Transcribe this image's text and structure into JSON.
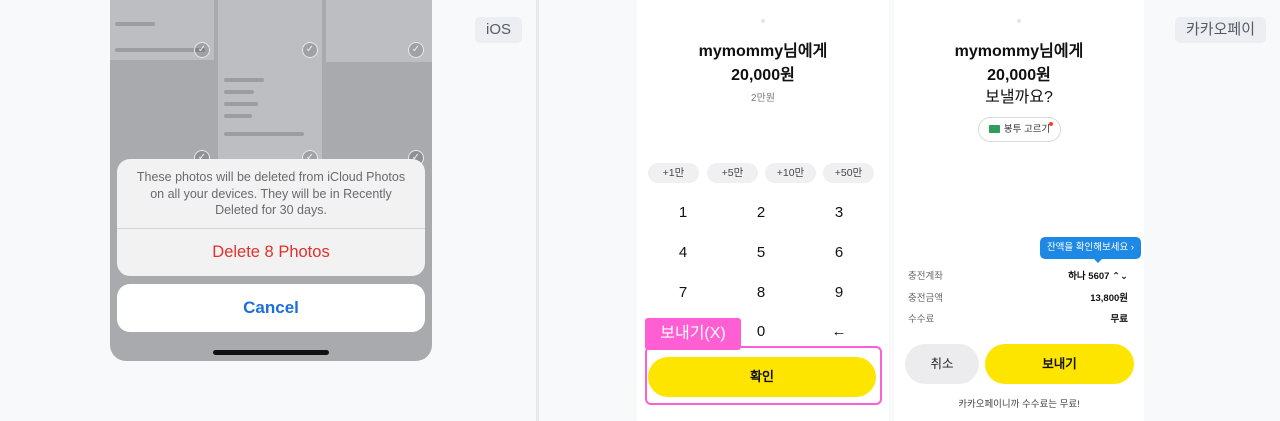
{
  "labels": {
    "ios_tag": "iOS",
    "kakao_tag": "카카오페이"
  },
  "ios": {
    "alert_message": "These photos will be deleted from iCloud Photos on all your devices. They will be in Recently Deleted for 30 days.",
    "delete_action": "Delete 8 Photos",
    "cancel_action": "Cancel"
  },
  "kakao_send": {
    "recipient": "mymommy님에게",
    "amount": "20,000원",
    "amount_hint": "2만원",
    "quick_amounts": [
      "+1만",
      "+5만",
      "+10만",
      "+50만"
    ],
    "keypad": [
      "1",
      "2",
      "3",
      "4",
      "5",
      "6",
      "7",
      "8",
      "9",
      "0",
      "←"
    ],
    "confirm_button": "확인",
    "highlight_label": "보내기(X)"
  },
  "kakao_confirm": {
    "recipient": "mymommy님에게",
    "amount": "20,000원",
    "question": "보낼까요?",
    "envelope_button": "봉투 고르기",
    "balance_tip": "잔액을 확인해보세요 ›",
    "rows": [
      {
        "label": "충전계좌",
        "value": "하나 5607 ⌃⌄"
      },
      {
        "label": "충전금액",
        "value": "13,800원"
      },
      {
        "label": "수수료",
        "value": "무료"
      }
    ],
    "cancel_button": "취소",
    "send_button": "보내기",
    "footer": "카카오페이니까 수수료는 무료!"
  },
  "colors": {
    "kakao_yellow": "#fee500",
    "highlight_pink": "#ff5fd2",
    "ios_destructive": "#e0322d",
    "ios_blue": "#1d6fd8",
    "tooltip_blue": "#1e88e5"
  }
}
